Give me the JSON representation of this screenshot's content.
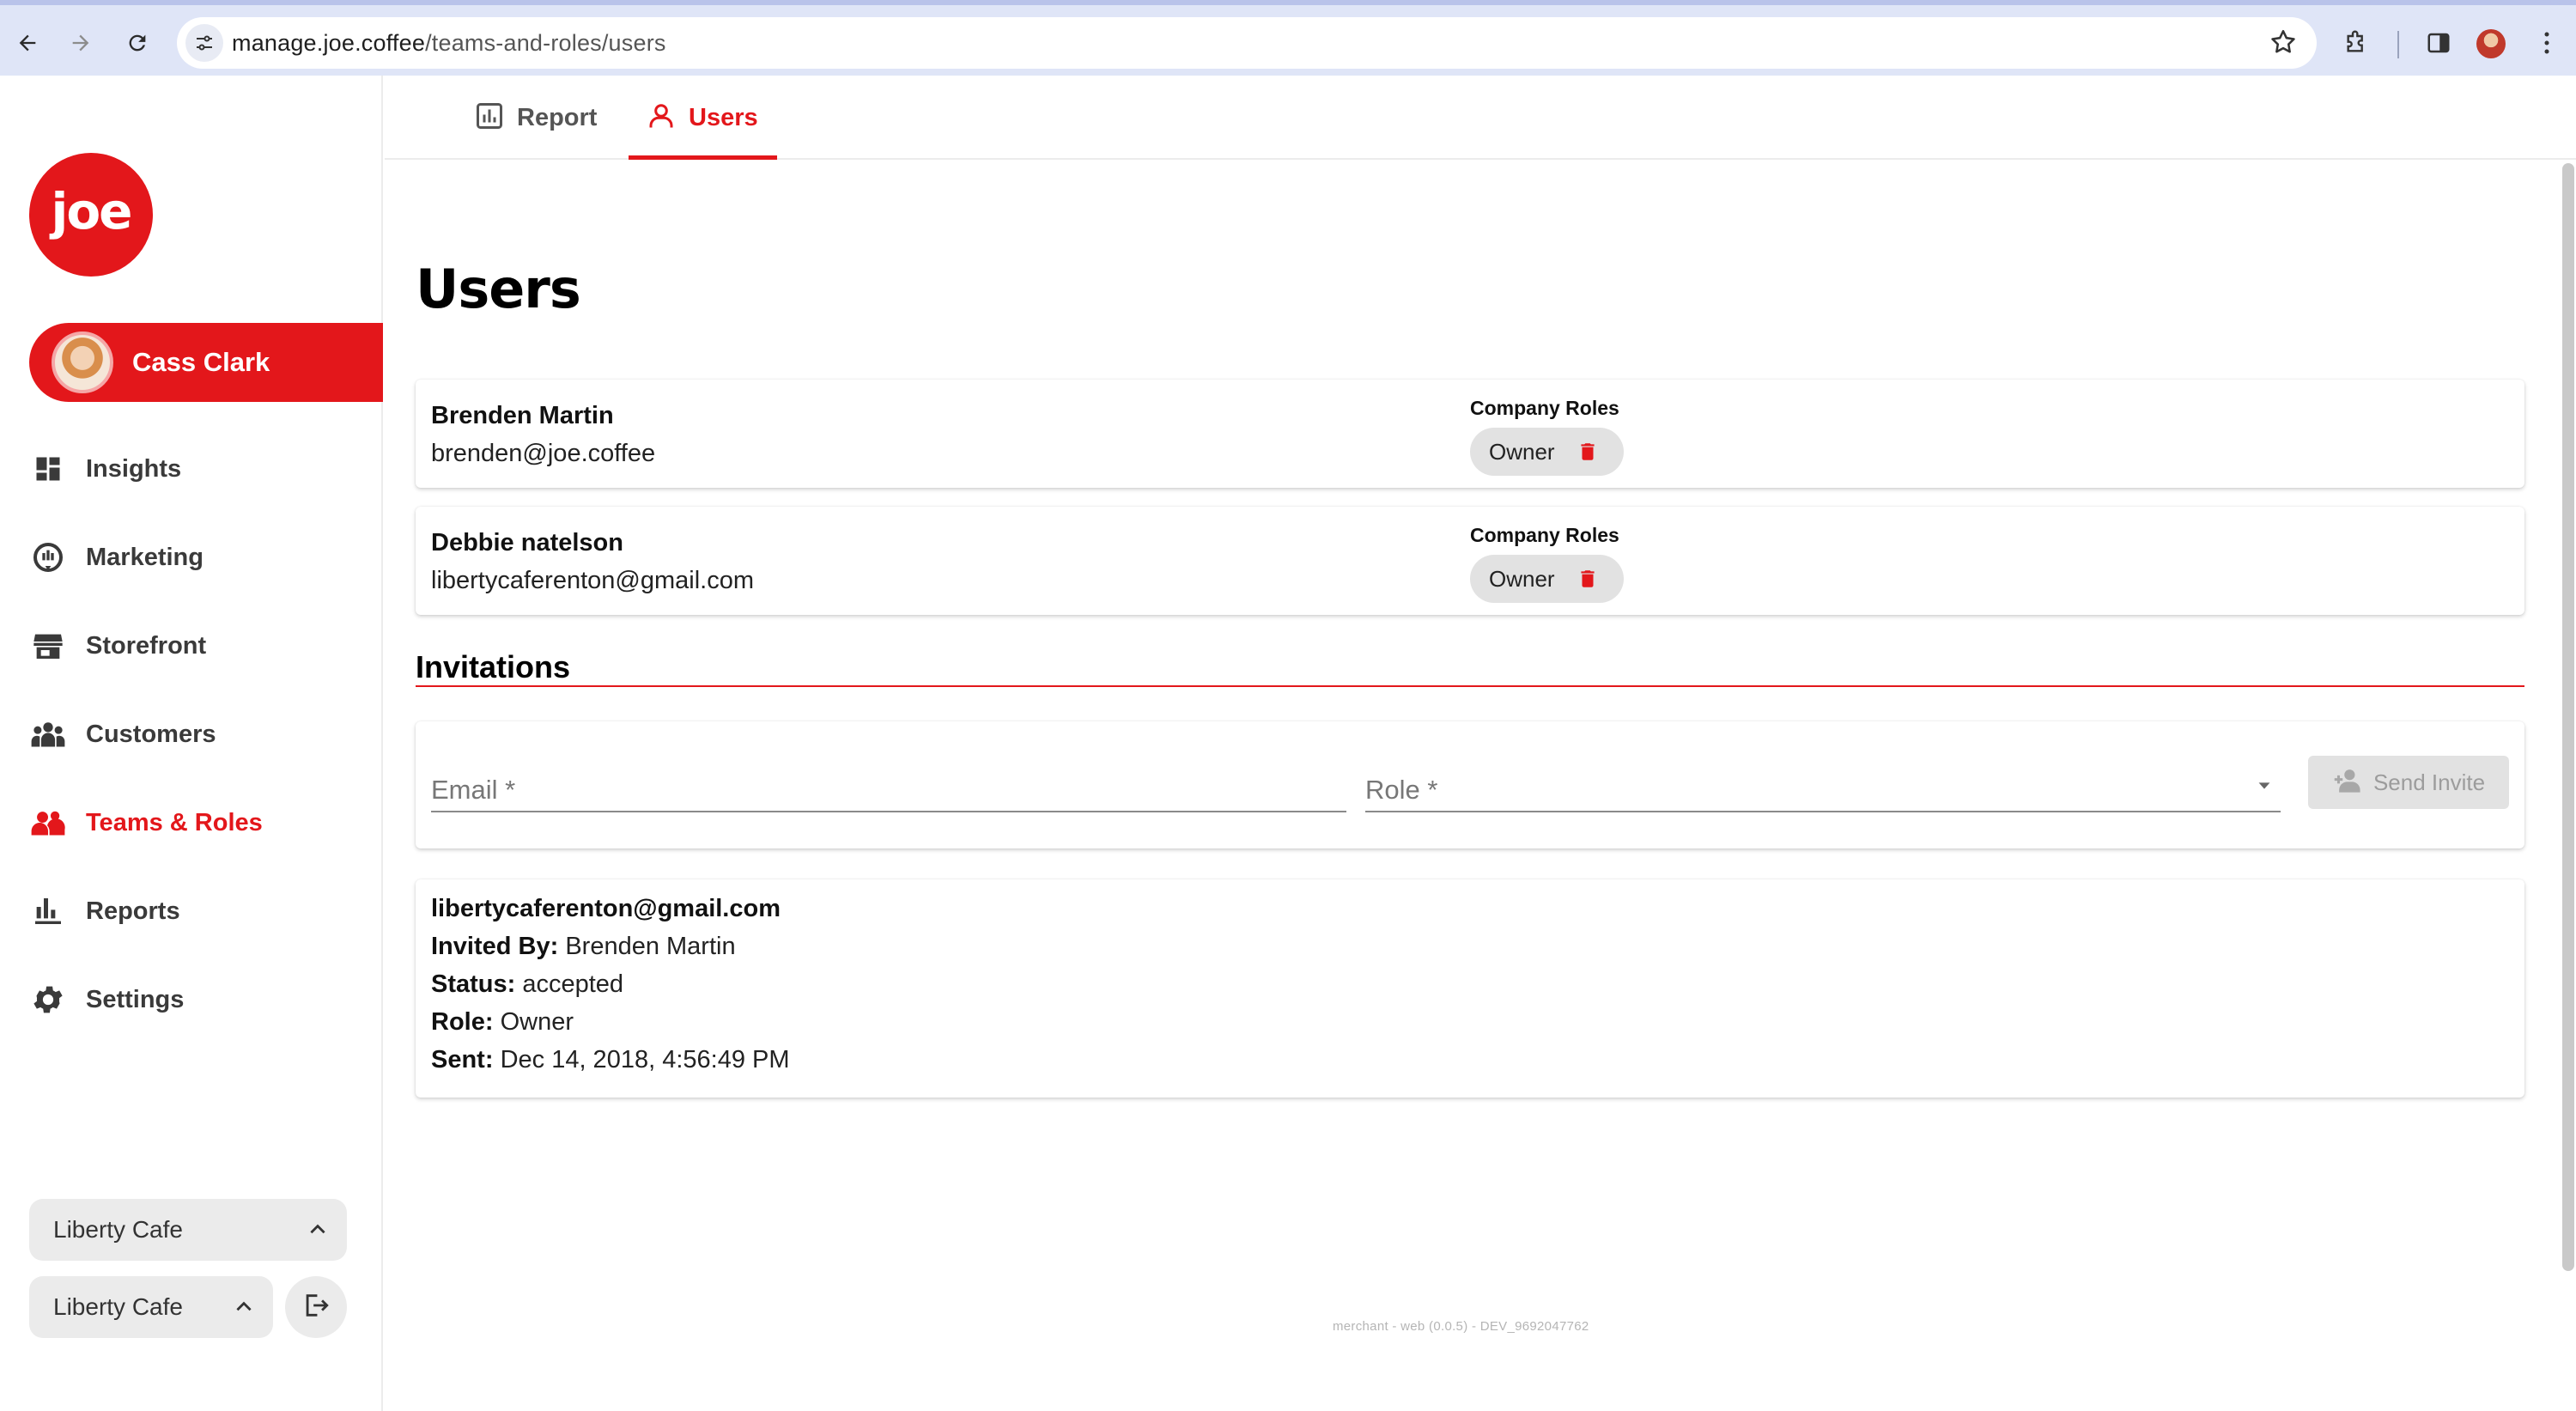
{
  "browser": {
    "url_host": "manage.joe.coffee",
    "url_path": "/teams-and-roles/users"
  },
  "sidebar": {
    "logo_text": "joe",
    "user_name": "Cass Clark",
    "items": [
      {
        "label": "Insights",
        "icon": "dashboard-icon"
      },
      {
        "label": "Marketing",
        "icon": "marketing-icon"
      },
      {
        "label": "Storefront",
        "icon": "storefront-icon"
      },
      {
        "label": "Customers",
        "icon": "customers-icon"
      },
      {
        "label": "Teams & Roles",
        "icon": "teams-icon",
        "active": true
      },
      {
        "label": "Reports",
        "icon": "bar-chart-icon"
      },
      {
        "label": "Settings",
        "icon": "gear-icon"
      }
    ],
    "company_select": "Liberty Cafe",
    "store_select": "Liberty Cafe"
  },
  "tabs": [
    {
      "label": "Report",
      "icon": "report-icon"
    },
    {
      "label": "Users",
      "icon": "user-icon",
      "active": true
    }
  ],
  "page": {
    "title": "Users"
  },
  "users": [
    {
      "name": "Brenden Martin",
      "email": "brenden@joe.coffee",
      "roles_label": "Company Roles",
      "role": "Owner"
    },
    {
      "name": "Debbie natelson",
      "email": "libertycaferenton@gmail.com",
      "roles_label": "Company Roles",
      "role": "Owner"
    }
  ],
  "invitations": {
    "title": "Invitations",
    "email_placeholder": "Email *",
    "role_placeholder": "Role *",
    "send_label": "Send Invite",
    "list": [
      {
        "email": "libertycaferenton@gmail.com",
        "invited_by_label": "Invited By:",
        "invited_by": "Brenden Martin",
        "status_label": "Status:",
        "status": "accepted",
        "role_label": "Role:",
        "role": "Owner",
        "sent_label": "Sent:",
        "sent": "Dec 14, 2018, 4:56:49 PM"
      }
    ]
  },
  "footer": {
    "version": "merchant - web (0.0.5) - DEV_9692047762"
  },
  "colors": {
    "brand": "#e3171b",
    "chrome": "#dfe5f7"
  }
}
